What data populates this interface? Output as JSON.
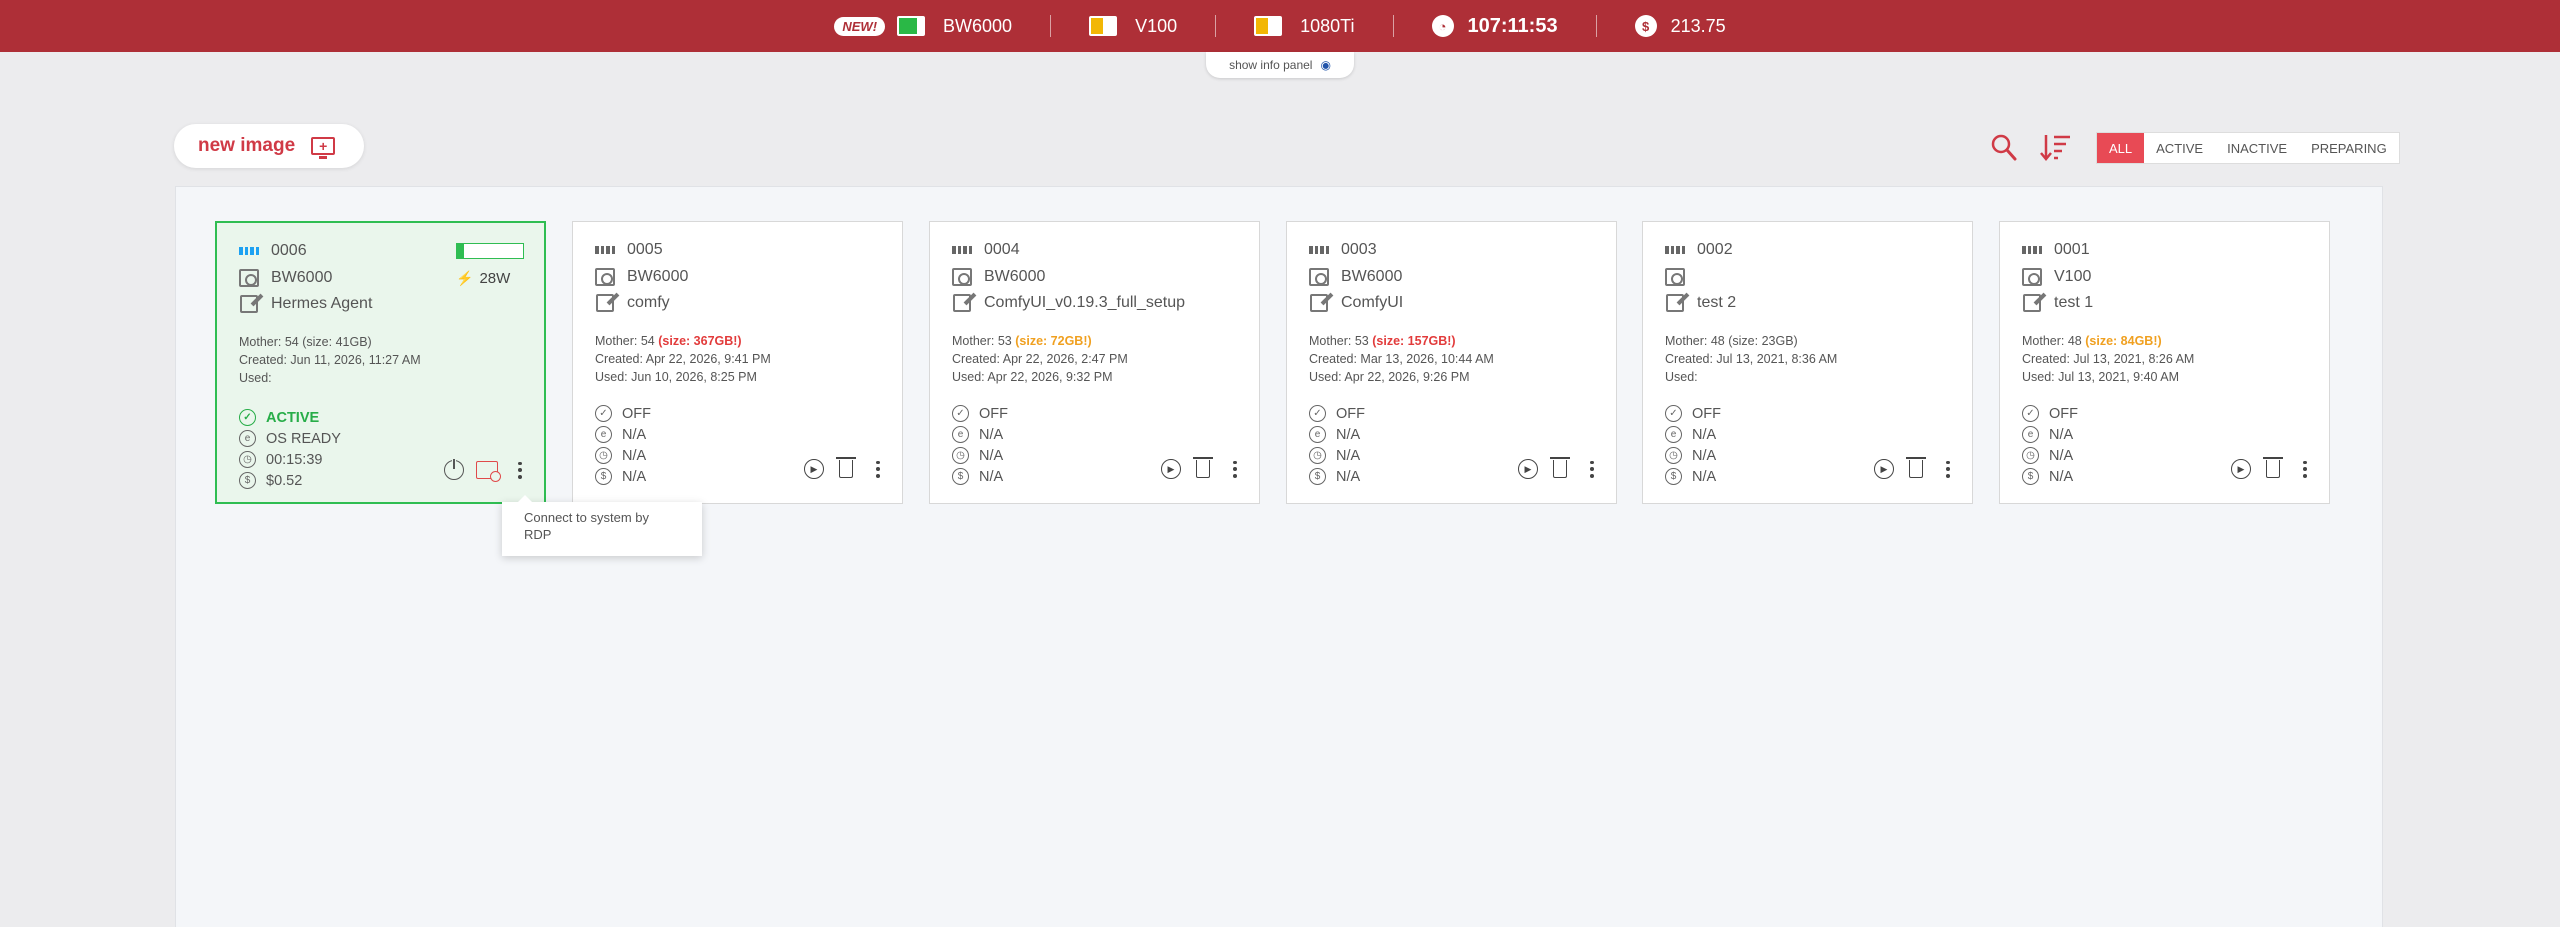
{
  "topbar": {
    "new_badge": "NEW!",
    "gpus": [
      {
        "name": "BW6000",
        "battery_color": "#2ab846",
        "level": 0.75
      },
      {
        "name": "V100",
        "battery_color": "#f2b705",
        "level": 0.5
      },
      {
        "name": "1080Ti",
        "battery_color": "#f2b705",
        "level": 0.5
      }
    ],
    "time": "107:11:53",
    "balance": "213.75",
    "clock_icon": "clock-icon",
    "dollar_icon": "dollar-icon"
  },
  "info_panel": {
    "label": "show info panel",
    "icon": "eye-icon"
  },
  "toolbar": {
    "new_image_label": "new image",
    "filters": [
      "ALL",
      "ACTIVE",
      "INACTIVE",
      "PREPARING"
    ],
    "active_filter": "ALL"
  },
  "cards": [
    {
      "id": "0006",
      "gpu": "BW6000",
      "name": "Hermes Agent",
      "mother": "Mother: 54 (size: 41GB)",
      "mother_warn": "",
      "created": "Created: Jun 11, 2026, 11:27 AM",
      "used": "Used:",
      "status": "ACTIVE",
      "os": "OS READY",
      "time": "00:15:39",
      "cost": "$0.52",
      "power": "28W",
      "load": 0.1,
      "active": true
    },
    {
      "id": "0005",
      "gpu": "BW6000",
      "name": "comfy",
      "mother": "Mother: 54 ",
      "mother_warn": "(size: 367GB!)",
      "warn_level": "bad",
      "created": "Created: Apr 22, 2026, 9:41 PM",
      "used": "Used: Jun 10, 2026, 8:25 PM",
      "status": "OFF",
      "os": "N/A",
      "time": "N/A",
      "cost": "N/A"
    },
    {
      "id": "0004",
      "gpu": "BW6000",
      "name": "ComfyUI_v0.19.3_full_setup",
      "mother": "Mother: 53 ",
      "mother_warn": "(size: 72GB!)",
      "warn_level": "warn",
      "created": "Created: Apr 22, 2026, 2:47 PM",
      "used": "Used: Apr 22, 2026, 9:32 PM",
      "status": "OFF",
      "os": "N/A",
      "time": "N/A",
      "cost": "N/A"
    },
    {
      "id": "0003",
      "gpu": "BW6000",
      "name": "ComfyUI",
      "mother": "Mother: 53 ",
      "mother_warn": "(size: 157GB!)",
      "warn_level": "bad",
      "created": "Created: Mar 13, 2026, 10:44 AM",
      "used": "Used: Apr 22, 2026, 9:26 PM",
      "status": "OFF",
      "os": "N/A",
      "time": "N/A",
      "cost": "N/A"
    },
    {
      "id": "0002",
      "gpu": "",
      "name": "test 2",
      "mother": "Mother: 48 (size: 23GB)",
      "mother_warn": "",
      "created": "Created: Jul 13, 2021, 8:36 AM",
      "used": "Used:",
      "status": "OFF",
      "os": "N/A",
      "time": "N/A",
      "cost": "N/A"
    },
    {
      "id": "0001",
      "gpu": "V100",
      "name": "test 1",
      "mother": "Mother: 48 ",
      "mother_warn": "(size: 84GB!)",
      "warn_level": "warn",
      "created": "Created: Jul 13, 2021, 8:26 AM",
      "used": "Used: Jul 13, 2021, 9:40 AM",
      "status": "OFF",
      "os": "N/A",
      "time": "N/A",
      "cost": "N/A"
    }
  ],
  "tooltip": {
    "text": "Connect to system by RDP"
  },
  "colors": {
    "brand": "#ae2f37",
    "accent": "#e84a55",
    "active": "#2fbd52",
    "warn": "#f0a020",
    "bad": "#e23b3b"
  }
}
